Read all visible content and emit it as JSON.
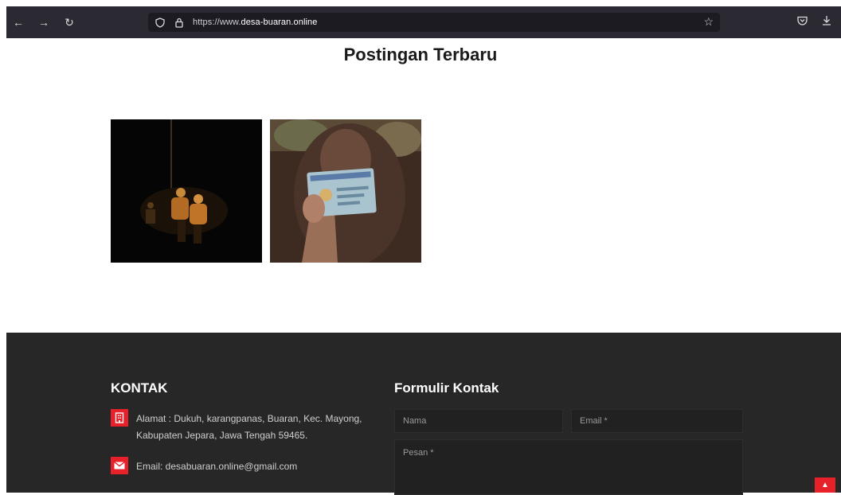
{
  "browser": {
    "url_prefix": "https://www.",
    "url_host": "desa-buaran.online"
  },
  "main": {
    "title": "Postingan Terbaru"
  },
  "footer": {
    "contact": {
      "heading": "KONTAK",
      "address": "Alamat : Dukuh, karangpanas, Buaran, Kec. Mayong, Kabupaten Jepara, Jawa Tengah 59465.",
      "email": "Email: desabuaran.online@gmail.com"
    },
    "form": {
      "heading": "Formulir Kontak",
      "name_placeholder": "Nama",
      "email_placeholder": "Email *",
      "message_placeholder": "Pesan *"
    }
  },
  "colors": {
    "accent": "#e8202a",
    "footer_bg": "#282727",
    "chrome_bg": "#2b2a33"
  },
  "icons": [
    "back-icon",
    "forward-icon",
    "reload-icon",
    "shield-icon",
    "lock-icon",
    "star-icon",
    "pocket-icon",
    "download-icon",
    "building-icon",
    "mail-icon",
    "chevron-up-icon"
  ]
}
